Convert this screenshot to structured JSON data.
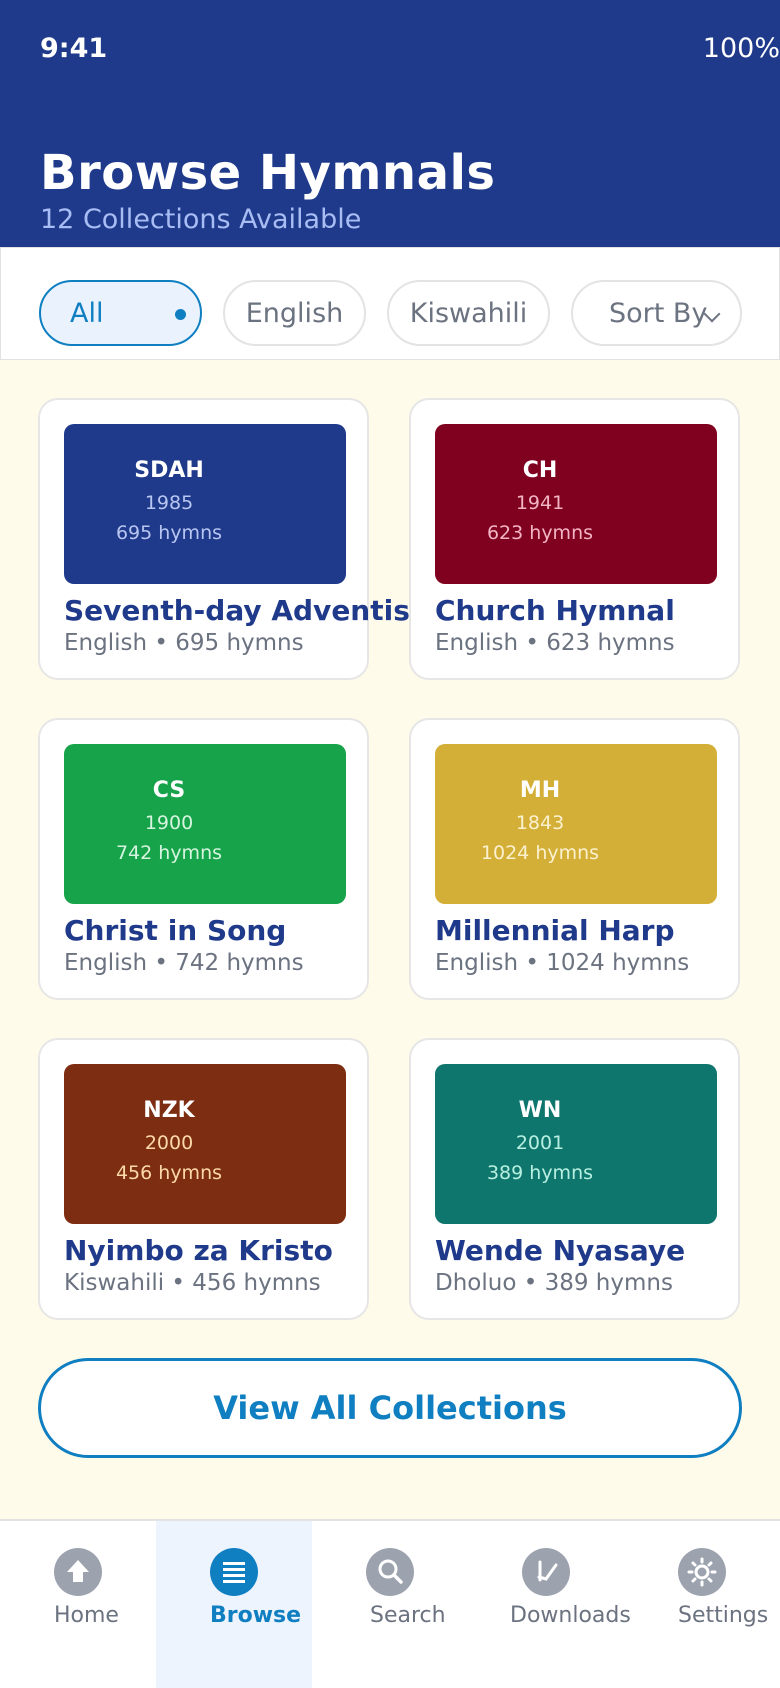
{
  "status_bar": {
    "time": "9:41",
    "battery": "100%"
  },
  "header": {
    "title": "Browse Hymnals",
    "subtitle": "12 Collections Available"
  },
  "filters": [
    {
      "label": "All",
      "active": true
    },
    {
      "label": "English",
      "active": false
    },
    {
      "label": "Kiswahili",
      "active": false
    }
  ],
  "sort": {
    "label": "Sort By"
  },
  "collections": [
    {
      "abbr": "SDAH",
      "year": "1985",
      "cover_count": "695 hymns",
      "title": "Seventh-day Adventis",
      "meta": "English • 695 hymns",
      "color": "#1f3a8a",
      "text_color": "#b9c6f2"
    },
    {
      "abbr": "CH",
      "year": "1941",
      "cover_count": "623 hymns",
      "title": "Church Hymnal",
      "meta": "English • 623 hymns",
      "color": "#800020",
      "text_color": "#f2b5c3"
    },
    {
      "abbr": "CS",
      "year": "1900",
      "cover_count": "742 hymns",
      "title": "Christ in Song",
      "meta": "English • 742 hymns",
      "color": "#16a34a",
      "text_color": "#d6f5df"
    },
    {
      "abbr": "MH",
      "year": "1843",
      "cover_count": "1024 hymns",
      "title": "Millennial Harp",
      "meta": "English • 1024 hymns",
      "color": "#d4af37",
      "text_color": "#fbf1cf"
    },
    {
      "abbr": "NZK",
      "year": "2000",
      "cover_count": "456 hymns",
      "title": "Nyimbo za Kristo",
      "meta": "Kiswahili • 456 hymns",
      "color": "#7c2d12",
      "text_color": "#fcd9a8"
    },
    {
      "abbr": "WN",
      "year": "2001",
      "cover_count": "389 hymns",
      "title": "Wende Nyasaye",
      "meta": "Dholuo • 389 hymns",
      "color": "#0f766e",
      "text_color": "#b7f0e0"
    }
  ],
  "view_all_label": "View All Collections",
  "bottom_nav": [
    {
      "label": "Home",
      "icon": "home-icon",
      "active": false
    },
    {
      "label": "Browse",
      "icon": "list-icon",
      "active": true
    },
    {
      "label": "Search",
      "icon": "search-icon",
      "active": false
    },
    {
      "label": "Downloads",
      "icon": "download-icon",
      "active": false
    },
    {
      "label": "Settings",
      "icon": "gear-icon",
      "active": false
    }
  ],
  "colors": {
    "primary": "#1f3a8a",
    "accent": "#0f7fc2",
    "background": "#fffbea"
  }
}
